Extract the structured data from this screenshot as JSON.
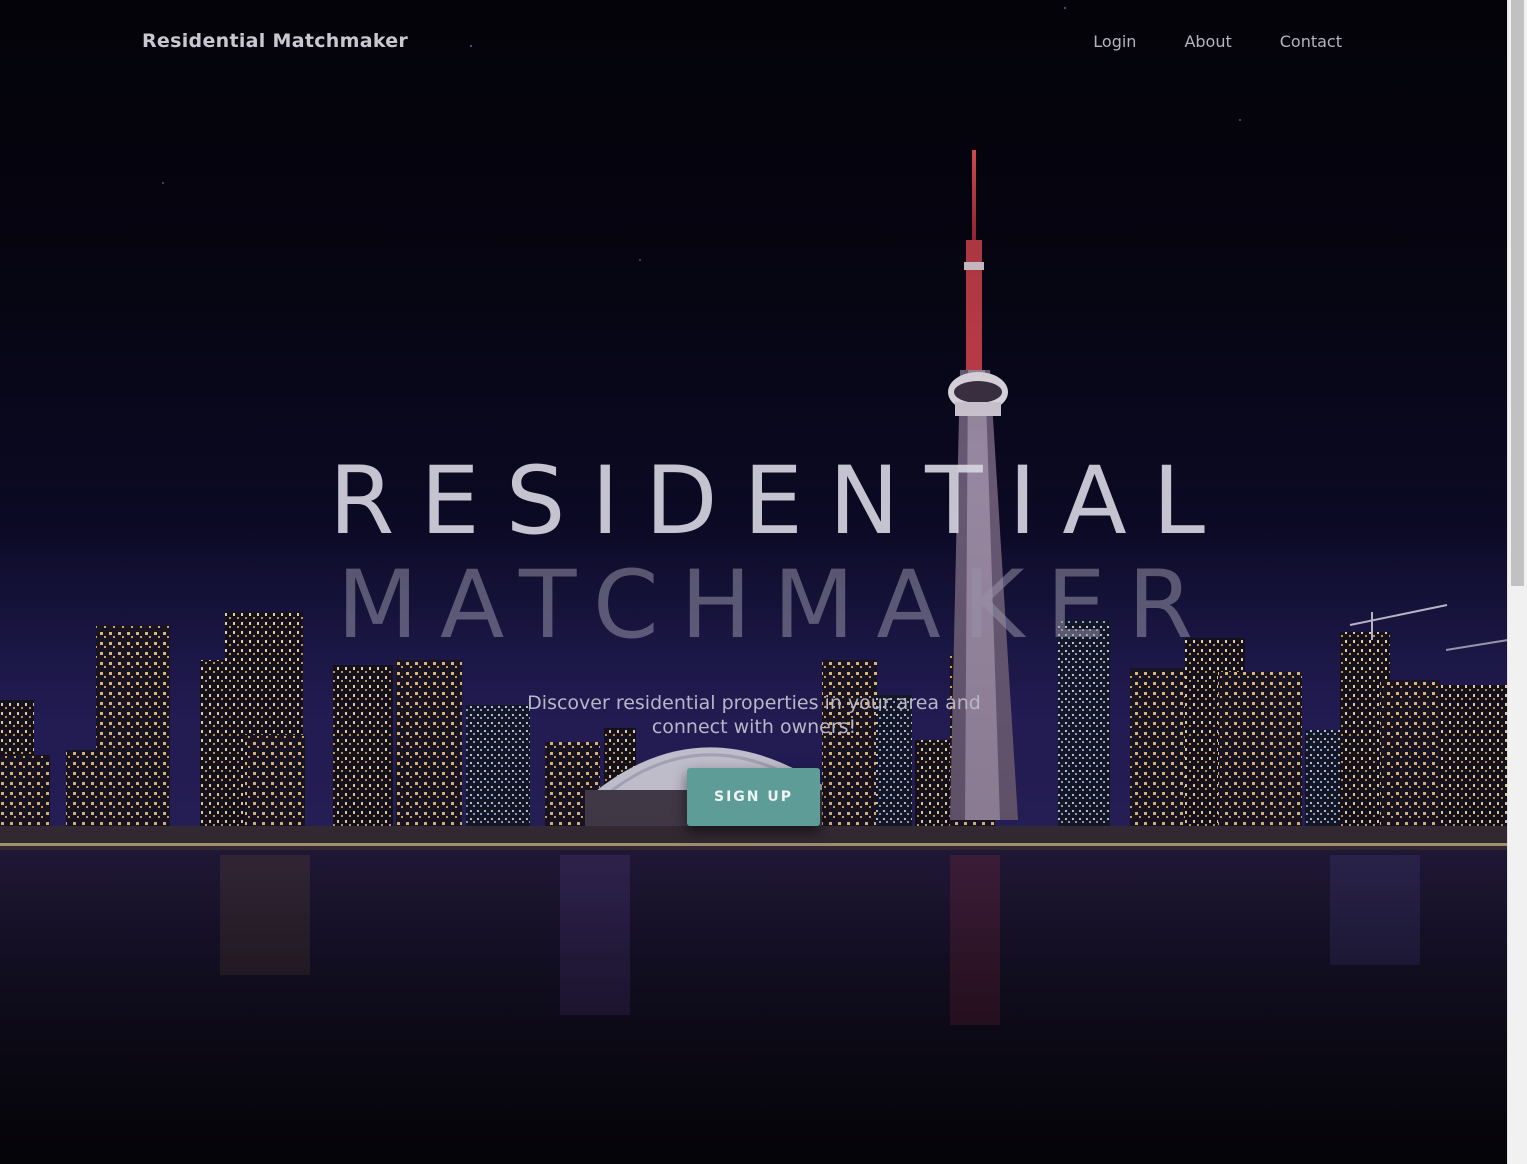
{
  "navbar": {
    "brand": "Residential Matchmaker",
    "links": [
      "Login",
      "About",
      "Contact"
    ]
  },
  "hero": {
    "title_line1": "RESIDENTIAL",
    "title_line2": "MATCHMAKER",
    "tagline": "Discover residential properties in your area and connect with owners!",
    "cta_label": "SIGN UP"
  },
  "colors": {
    "cta": "#5e9c98",
    "background": "#07060f"
  }
}
